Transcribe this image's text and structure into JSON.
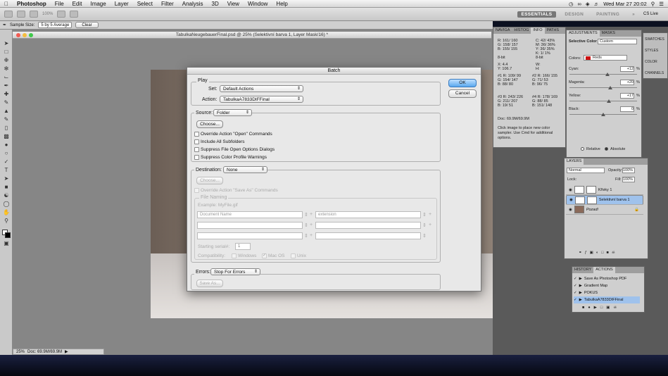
{
  "menubar": {
    "app": "Photoshop",
    "items": [
      "File",
      "Edit",
      "Image",
      "Layer",
      "Select",
      "Filter",
      "Analysis",
      "3D",
      "View",
      "Window",
      "Help"
    ],
    "clock": "Wed Mar 27  20:02"
  },
  "options": {
    "zoom": "100%",
    "workspaces": [
      "ESSENTIALS",
      "DESIGN",
      "PAINTING"
    ],
    "cslive": "CS Live",
    "sample_label": "Sample Size:",
    "sample_value": "5 by 5 Average",
    "clear": "Clear"
  },
  "document": {
    "title": "TabulkaNeugebauerFinal.psd @ 25% (Selektivní barva 1, Layer Mask/16) *",
    "zoom": "25%",
    "doc": "Doc: 69.9M/69.9M"
  },
  "dialog": {
    "title": "Batch",
    "play_label": "Play",
    "set_label": "Set:",
    "set_value": "Default Actions",
    "action_label": "Action:",
    "action_value": "TabulkaA7833DIFFinal",
    "source_label": "Source:",
    "source_value": "Folder",
    "choose": "Choose...",
    "source_options": [
      "Override Action \"Open\" Commands",
      "Include All Subfolders",
      "Suppress File Open Options Dialogs",
      "Suppress Color Profile Warnings"
    ],
    "dest_label": "Destination:",
    "dest_value": "None",
    "override_save": "Override Action \"Save As\" Commands",
    "file_naming": "File Naming",
    "example": "Example: MyFile.gif",
    "name1": "Document Name",
    "name2": "extension",
    "serial_label": "Starting serial#:",
    "serial_value": "1",
    "compat_label": "Compatibility:",
    "compat": [
      "Windows",
      "Mac OS",
      "Unix"
    ],
    "errors_label": "Errors:",
    "errors_value": "Stop For Errors",
    "save_as": "Save As...",
    "ok": "OK",
    "cancel": "Cancel"
  },
  "info_panel": {
    "tabs": [
      "NAVIGA",
      "HISTOG",
      "INFO",
      "PATHS"
    ],
    "rgb": [
      "R:  161/ 160",
      "G:  158/ 157",
      "B:  155/ 155"
    ],
    "cmyk": [
      "C:  42/ 43%",
      "M:  36/ 36%",
      "Y:  36/ 35%",
      "K:   1/  1%"
    ],
    "bit1": "8-bit",
    "bit2": "8-bit",
    "xy": [
      "X:    4.4",
      "Y:  106.7"
    ],
    "wh": [
      "W:",
      "H:"
    ],
    "s1": [
      "#1 R:  109/ 99",
      "G:  154/ 147",
      "B:   88/ 80"
    ],
    "s2": [
      "#2 R:  166/ 155",
      "G:   71/ 53",
      "B:   96/ 75"
    ],
    "s3": [
      "#3 R:  243/ 226",
      "G:  211/ 207",
      "B:   19/ 51"
    ],
    "s4": [
      "#4 R:  178/ 169",
      "G:   88/ 85",
      "B:  151/ 148"
    ],
    "doc": "Doc: 69.9M/69.9M",
    "hint": "Click image to place new color sampler. Use Cmd for additional options."
  },
  "adjustments": {
    "tabs": [
      "ADJUSTMENTS",
      "MASKS"
    ],
    "title": "Selective Color",
    "preset": "Custom",
    "colors_label": "Colors:",
    "colors_value": "Reds",
    "sliders": [
      {
        "label": "Cyan:",
        "value": "+12",
        "unit": "%",
        "level": 0.56
      },
      {
        "label": "Magenta:",
        "value": "+20",
        "unit": "%",
        "level": 0.6
      },
      {
        "label": "Yellow:",
        "value": "+17",
        "unit": "%",
        "level": 0.58
      },
      {
        "label": "Black:",
        "value": "0",
        "unit": "%",
        "level": 0.5
      }
    ],
    "relative": "Relative",
    "absolute": "Absolute"
  },
  "side_panels": [
    "SWATCHES",
    "STYLES",
    "COLOR",
    "CHANNELS"
  ],
  "layers": {
    "tab": "LAYERS",
    "blend": "Normal",
    "opacity_label": "Opacity:",
    "opacity": "100%",
    "lock_label": "Lock:",
    "fill_label": "Fill:",
    "fill": "100%",
    "items": [
      {
        "name": "Křivky 1",
        "selected": false
      },
      {
        "name": "Selektivní barva 1",
        "selected": true
      },
      {
        "name": "Pozadí",
        "selected": false
      }
    ]
  },
  "actions": {
    "tabs": [
      "HISTORY",
      "ACTIONS"
    ],
    "items": [
      "Save As Photoshop PDF",
      "Gradient Map",
      "POKUS",
      "TabulkaA7833DIFFinal"
    ]
  },
  "colors": {
    "accent": "#3a7cc0",
    "selected_layer": "#9fc2ec",
    "reds_swatch": "#cc1111"
  }
}
